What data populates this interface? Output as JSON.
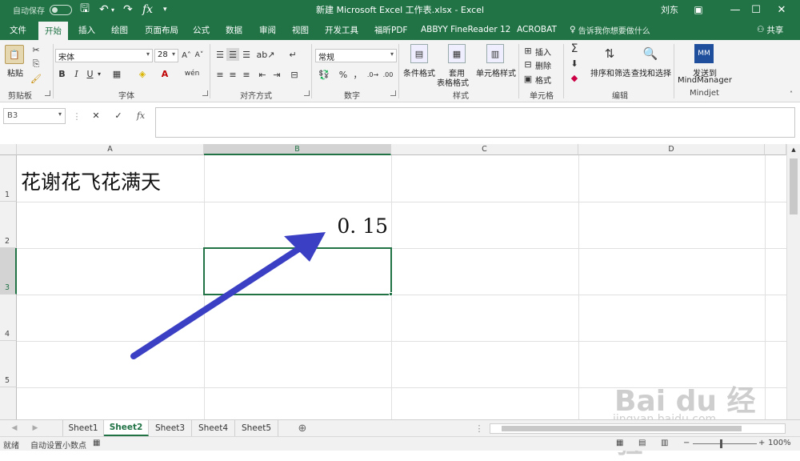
{
  "titlebar": {
    "autosave_label": "自动保存",
    "autosave_state": "off",
    "title": "新建 Microsoft Excel 工作表.xlsx - Excel",
    "user": "刘东"
  },
  "tabs": [
    "文件",
    "开始",
    "插入",
    "绘图",
    "页面布局",
    "公式",
    "数据",
    "审阅",
    "视图",
    "开发工具",
    "福昕PDF",
    "ABBYY FineReader 12",
    "ACROBAT"
  ],
  "active_tab": "开始",
  "tell_me": "告诉我你想要做什么",
  "share": "共享",
  "ribbon": {
    "clipboard": {
      "paste": "粘贴",
      "label": "剪贴板"
    },
    "font": {
      "name": "宋体",
      "size": "28",
      "bold": "B",
      "italic": "I",
      "underline": "U",
      "label": "字体"
    },
    "align": {
      "label": "对齐方式"
    },
    "number": {
      "format": "常规",
      "percent": "%",
      "comma": "，",
      "label": "数字"
    },
    "styles": {
      "conditional": "条件格式",
      "table1": "套用",
      "table2": "表格格式",
      "cell": "单元格样式",
      "label": "样式"
    },
    "cells": {
      "insert": "插入",
      "delete": "删除",
      "format": "格式",
      "label": "单元格"
    },
    "editing": {
      "sort": "排序和筛选",
      "find": "查找和选择",
      "label": "编辑"
    },
    "mindjet": {
      "send1": "发送到",
      "send2": "MindManager",
      "label": "Mindjet"
    }
  },
  "formula_bar": {
    "name_box": "B3",
    "fx": "fx",
    "value": ""
  },
  "columns": [
    "A",
    "B",
    "C",
    "D"
  ],
  "rows": [
    "1",
    "2",
    "3",
    "4",
    "5"
  ],
  "cells": {
    "A1": "花谢花飞花满天",
    "B2": "0. 15"
  },
  "selected_cell": "B3",
  "sheets": [
    "Sheet1",
    "Sheet2",
    "Sheet3",
    "Sheet4",
    "Sheet5"
  ],
  "active_sheet": "Sheet2",
  "status": {
    "ready": "就绪",
    "auto_decimal": "自动设置小数点",
    "zoom": "100%"
  },
  "watermark": {
    "brand": "Bai du 经验",
    "url": "jingyan.baidu.com"
  },
  "colors": {
    "excel_green": "#217346",
    "arrow_blue": "#3b3fc4"
  }
}
